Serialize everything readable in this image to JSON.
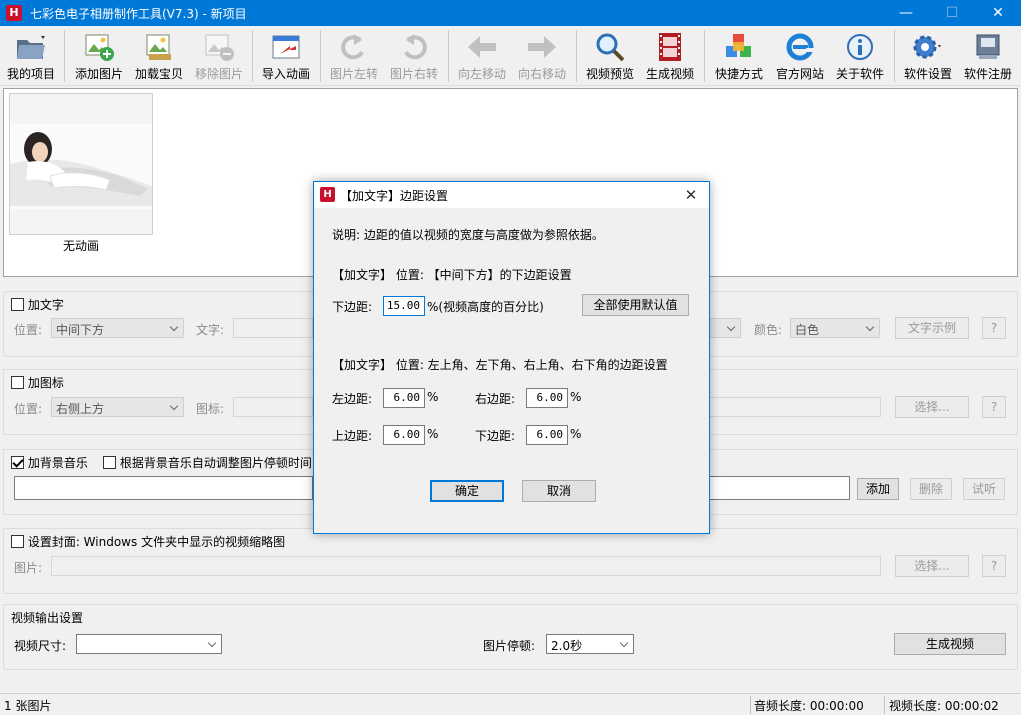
{
  "window": {
    "title": "七彩色电子相册制作工具(V7.3) - 新项目",
    "icon_letter": "H",
    "icon_color": "#c8102e",
    "accent": "#0078d7"
  },
  "toolbar": {
    "items": [
      {
        "label": "我的项目",
        "icon": "folder-icon",
        "enabled": true
      },
      {
        "label": "添加图片",
        "icon": "add-image-icon",
        "enabled": true
      },
      {
        "label": "加载宝贝",
        "icon": "load-images-icon",
        "enabled": true
      },
      {
        "label": "移除图片",
        "icon": "remove-image-icon",
        "enabled": false
      },
      {
        "label": "导入动画",
        "icon": "import-animation-icon",
        "enabled": true
      },
      {
        "label": "图片左转",
        "icon": "rotate-left-icon",
        "enabled": false
      },
      {
        "label": "图片右转",
        "icon": "rotate-right-icon",
        "enabled": false
      },
      {
        "label": "向左移动",
        "icon": "arrow-left-icon",
        "enabled": false
      },
      {
        "label": "向右移动",
        "icon": "arrow-right-icon",
        "enabled": false
      },
      {
        "label": "视频预览",
        "icon": "magnifier-icon",
        "enabled": true
      },
      {
        "label": "生成视频",
        "icon": "film-icon",
        "enabled": true
      },
      {
        "label": "快捷方式",
        "icon": "cubes-icon",
        "enabled": true
      },
      {
        "label": "官方网站",
        "icon": "ie-icon",
        "enabled": true
      },
      {
        "label": "关于软件",
        "icon": "info-icon",
        "enabled": true
      },
      {
        "label": "软件设置",
        "icon": "gear-icon",
        "enabled": true
      },
      {
        "label": "软件注册",
        "icon": "register-icon",
        "enabled": true
      }
    ]
  },
  "thumbnails": [
    {
      "caption": "无动画"
    }
  ],
  "add_text": {
    "checkbox_label": "加文字",
    "checked": false,
    "position_label": "位置:",
    "position_value": "中间下方",
    "text_label": "文字:",
    "color_label": "颜色:",
    "color_value": "白色",
    "sample_button": "文字示例",
    "help_button": "?"
  },
  "add_icon": {
    "checkbox_label": "加图标",
    "checked": false,
    "position_label": "位置:",
    "position_value": "右侧上方",
    "icon_label": "图标:",
    "select_button": "选择...",
    "help_button": "?"
  },
  "bg_music": {
    "checkbox_label": "加背景音乐",
    "checked": true,
    "auto_adjust_label": "根据背景音乐自动调整图片停顿时间",
    "auto_adjust_checked": false,
    "add_button": "添加",
    "delete_button": "删除",
    "listen_button": "试听"
  },
  "cover": {
    "checkbox_label": "设置封面: Windows 文件夹中显示的视频缩略图",
    "checked": false,
    "image_label": "图片:",
    "select_button": "选择...",
    "help_button": "?"
  },
  "video_output": {
    "group_label": "视频输出设置",
    "size_label": "视频尺寸:",
    "size_value": "",
    "pause_label": "图片停顿:",
    "pause_value": "2.0秒",
    "generate_button": "生成视频"
  },
  "status": {
    "image_count": "1 张图片",
    "audio_length": "音频长度: 00:00:00",
    "video_length": "视频长度: 00:00:02"
  },
  "dialog": {
    "title": "【加文字】边距设置",
    "description": "说明: 边距的值以视频的宽度与高度做为参照依据。",
    "section1_heading": "【加文字】 位置: 【中间下方】的下边距设置",
    "bottom_margin_label": "下边距:",
    "bottom_margin_value": "15.00",
    "bottom_margin_unit": "%(视频高度的百分比)",
    "reset_defaults_button": "全部使用默认值",
    "section2_heading": "【加文字】 位置: 左上角、左下角、右上角、右下角的边距设置",
    "left_label": "左边距:",
    "left_value": "6.00",
    "right_label": "右边距:",
    "right_value": "6.00",
    "top_label": "上边距:",
    "top_value": "6.00",
    "bottom_label": "下边距:",
    "bottom_value": "6.00",
    "percent": "%",
    "ok_button": "确定",
    "cancel_button": "取消"
  }
}
